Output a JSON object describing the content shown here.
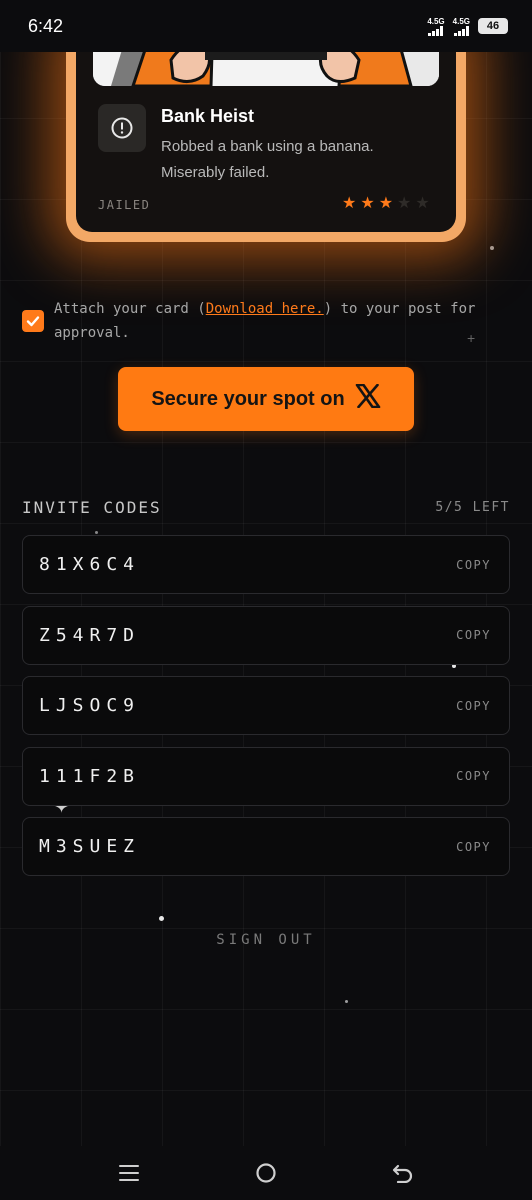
{
  "status_bar": {
    "time": "6:42",
    "signal1_label": "4.5G",
    "signal2_label": "4.5G",
    "battery": "46"
  },
  "card": {
    "title": "Bank Heist",
    "description": "Robbed a bank using a banana. Miserably failed.",
    "status": "JAILED",
    "rating": 3,
    "rating_max": 5,
    "accent_color": "#ff7a1a"
  },
  "attach": {
    "checked": true,
    "text_before": "Attach your card (",
    "link_text": "Download here.",
    "text_after": ") to your post for approval."
  },
  "cta": {
    "label": "Secure your spot on",
    "icon": "x-logo-icon"
  },
  "invite": {
    "title": "INVITE CODES",
    "remaining": "5/5 LEFT",
    "copy_label": "COPY",
    "codes": [
      "81X6C4",
      "Z54R7D",
      "LJSOC9",
      "111F2B",
      "M3SUEZ"
    ]
  },
  "sign_out": "SIGN OUT",
  "nav": {
    "recents_icon": "menu-icon",
    "home_icon": "circle-home-icon",
    "back_icon": "back-arrow-icon"
  }
}
